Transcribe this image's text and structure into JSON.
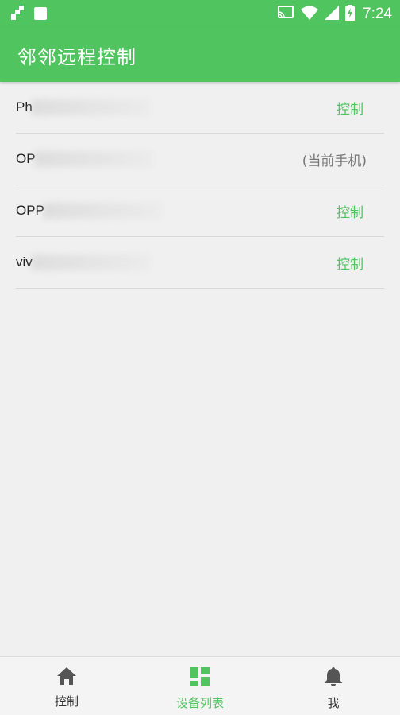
{
  "status_bar": {
    "time": "7:24",
    "icons": [
      "app-notification-icon",
      "square-notification-icon",
      "cast-icon",
      "wifi-icon",
      "cell-signal-icon",
      "battery-charging-icon"
    ]
  },
  "app_bar": {
    "title": "邻邻远程控制"
  },
  "devices": [
    {
      "name_prefix": "Ph",
      "action": "控制",
      "is_current": false
    },
    {
      "name_prefix": "OP",
      "action": "(当前手机)",
      "is_current": true
    },
    {
      "name_prefix": "OPP",
      "action": "控制",
      "is_current": false
    },
    {
      "name_prefix": "viv",
      "action": "控制",
      "is_current": false
    }
  ],
  "bottom_nav": {
    "items": [
      {
        "label": "控制",
        "icon": "home-icon",
        "active": false
      },
      {
        "label": "设备列表",
        "icon": "grid-icon",
        "active": true
      },
      {
        "label": "我",
        "icon": "bell-icon",
        "active": false
      }
    ]
  },
  "colors": {
    "primary": "#4fc45f",
    "background": "#f0f0f0",
    "divider": "#d9d9d9"
  }
}
